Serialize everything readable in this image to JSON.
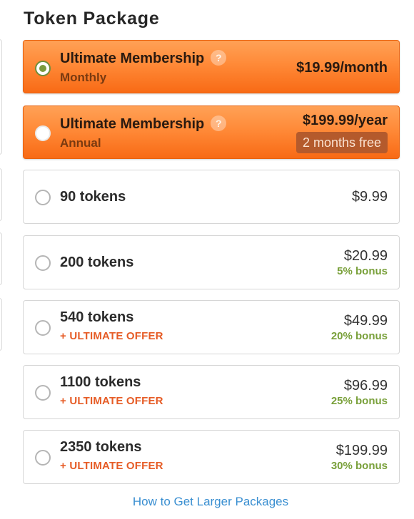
{
  "title": "Token Package",
  "colors": {
    "accent_orange": "#f86a15",
    "selected_green": "#7a9a3d",
    "bonus_green": "#79a03a",
    "ultimate_red": "#e65c26",
    "link_blue": "#3a8fd1"
  },
  "memberships": [
    {
      "name": "Ultimate Membership",
      "period": "Monthly",
      "price": "$19.99/month",
      "help": "?",
      "selected": true
    },
    {
      "name": "Ultimate Membership",
      "period": "Annual",
      "price": "$199.99/year",
      "badge": "2 months free",
      "help": "?",
      "selected": false
    }
  ],
  "packages": [
    {
      "name": "90 tokens",
      "price": "$9.99"
    },
    {
      "name": "200 tokens",
      "price": "$20.99",
      "bonus": "5% bonus"
    },
    {
      "name": "540 tokens",
      "price": "$49.99",
      "bonus": "20% bonus",
      "offer": "+ ULTIMATE OFFER"
    },
    {
      "name": "1100 tokens",
      "price": "$96.99",
      "bonus": "25% bonus",
      "offer": "+ ULTIMATE OFFER"
    },
    {
      "name": "2350 tokens",
      "price": "$199.99",
      "bonus": "30% bonus",
      "offer": "+ ULTIMATE OFFER"
    }
  ],
  "larger_packages_link": "How to Get Larger Packages"
}
